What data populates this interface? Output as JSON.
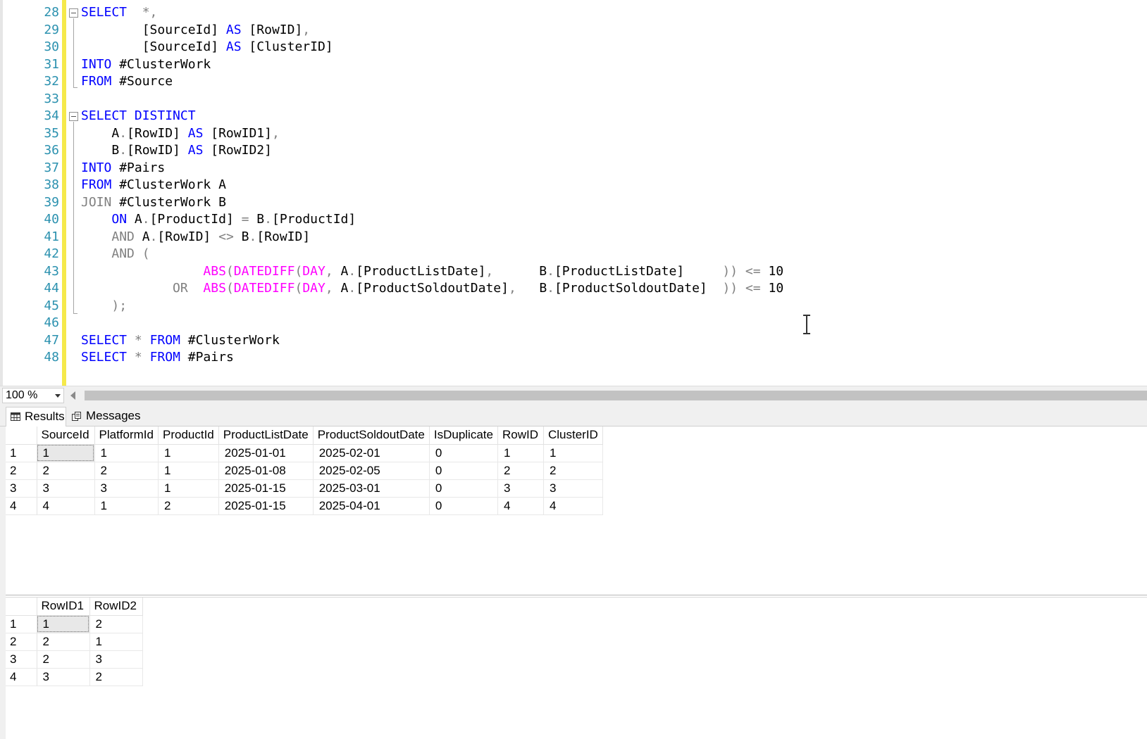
{
  "editor": {
    "line_numbers": [
      "28",
      "29",
      "30",
      "31",
      "32",
      "33",
      "34",
      "35",
      "36",
      "37",
      "38",
      "39",
      "40",
      "41",
      "42",
      "43",
      "44",
      "45",
      "46",
      "47",
      "48"
    ],
    "lines": [
      [
        [
          "k",
          "SELECT"
        ],
        [
          "o",
          "  *,"
        ]
      ],
      [
        [
          "t",
          "        [SourceId] "
        ],
        [
          "k",
          "AS"
        ],
        [
          "t",
          " [RowID]"
        ],
        [
          "o",
          ","
        ]
      ],
      [
        [
          "t",
          "        [SourceId] "
        ],
        [
          "k",
          "AS"
        ],
        [
          "t",
          " [ClusterID]"
        ]
      ],
      [
        [
          "k",
          "INTO"
        ],
        [
          "t",
          " #ClusterWork"
        ]
      ],
      [
        [
          "k",
          "FROM"
        ],
        [
          "t",
          " #Source"
        ]
      ],
      [],
      [
        [
          "k",
          "SELECT DISTINCT"
        ]
      ],
      [
        [
          "t",
          "    A"
        ],
        [
          "o",
          "."
        ],
        [
          "t",
          "[RowID] "
        ],
        [
          "k",
          "AS"
        ],
        [
          "t",
          " [RowID1]"
        ],
        [
          "o",
          ","
        ]
      ],
      [
        [
          "t",
          "    B"
        ],
        [
          "o",
          "."
        ],
        [
          "t",
          "[RowID] "
        ],
        [
          "k",
          "AS"
        ],
        [
          "t",
          " [RowID2]"
        ]
      ],
      [
        [
          "k",
          "INTO"
        ],
        [
          "t",
          " #Pairs"
        ]
      ],
      [
        [
          "k",
          "FROM"
        ],
        [
          "t",
          " #ClusterWork A"
        ]
      ],
      [
        [
          "o",
          "JOIN"
        ],
        [
          "t",
          " #ClusterWork B"
        ]
      ],
      [
        [
          "t",
          "    "
        ],
        [
          "k",
          "ON"
        ],
        [
          "t",
          " A"
        ],
        [
          "o",
          "."
        ],
        [
          "t",
          "[ProductId] "
        ],
        [
          "o",
          "="
        ],
        [
          "t",
          " B"
        ],
        [
          "o",
          "."
        ],
        [
          "t",
          "[ProductId]"
        ]
      ],
      [
        [
          "t",
          "    "
        ],
        [
          "o",
          "AND"
        ],
        [
          "t",
          " A"
        ],
        [
          "o",
          "."
        ],
        [
          "t",
          "[RowID] "
        ],
        [
          "o",
          "<>"
        ],
        [
          "t",
          " B"
        ],
        [
          "o",
          "."
        ],
        [
          "t",
          "[RowID]"
        ]
      ],
      [
        [
          "t",
          "    "
        ],
        [
          "o",
          "AND ("
        ]
      ],
      [
        [
          "t",
          "                "
        ],
        [
          "f",
          "ABS"
        ],
        [
          "o",
          "("
        ],
        [
          "f",
          "DATEDIFF"
        ],
        [
          "o",
          "("
        ],
        [
          "f",
          "DAY"
        ],
        [
          "o",
          ","
        ],
        [
          "t",
          " A"
        ],
        [
          "o",
          "."
        ],
        [
          "t",
          "[ProductListDate]"
        ],
        [
          "o",
          ","
        ],
        [
          "t",
          "      B"
        ],
        [
          "o",
          "."
        ],
        [
          "t",
          "[ProductListDate]     "
        ],
        [
          "o",
          "))"
        ],
        [
          "t",
          " "
        ],
        [
          "o",
          "<="
        ],
        [
          "t",
          " 10"
        ]
      ],
      [
        [
          "t",
          "            "
        ],
        [
          "o",
          "OR"
        ],
        [
          "t",
          "  "
        ],
        [
          "f",
          "ABS"
        ],
        [
          "o",
          "("
        ],
        [
          "f",
          "DATEDIFF"
        ],
        [
          "o",
          "("
        ],
        [
          "f",
          "DAY"
        ],
        [
          "o",
          ","
        ],
        [
          "t",
          " A"
        ],
        [
          "o",
          "."
        ],
        [
          "t",
          "[ProductSoldoutDate]"
        ],
        [
          "o",
          ","
        ],
        [
          "t",
          "   B"
        ],
        [
          "o",
          "."
        ],
        [
          "t",
          "[ProductSoldoutDate]  "
        ],
        [
          "o",
          "))"
        ],
        [
          "t",
          " "
        ],
        [
          "o",
          "<="
        ],
        [
          "t",
          " 10"
        ]
      ],
      [
        [
          "t",
          "    "
        ],
        [
          "o",
          ");"
        ]
      ],
      [],
      [
        [
          "k",
          "SELECT"
        ],
        [
          "t",
          " "
        ],
        [
          "o",
          "*"
        ],
        [
          "t",
          " "
        ],
        [
          "k",
          "FROM"
        ],
        [
          "t",
          " #ClusterWork"
        ]
      ],
      [
        [
          "k",
          "SELECT"
        ],
        [
          "t",
          " "
        ],
        [
          "o",
          "*"
        ],
        [
          "t",
          " "
        ],
        [
          "k",
          "FROM"
        ],
        [
          "t",
          " #Pairs"
        ]
      ]
    ]
  },
  "zoom": {
    "value": "100 %"
  },
  "tabs": {
    "results": "Results",
    "messages": "Messages"
  },
  "grid1": {
    "columns": [
      "SourceId",
      "PlatformId",
      "ProductId",
      "ProductListDate",
      "ProductSoldoutDate",
      "IsDuplicate",
      "RowID",
      "ClusterID"
    ],
    "rows": [
      [
        "1",
        "1",
        "1",
        "1",
        "2025-01-01",
        "2025-02-01",
        "0",
        "1",
        "1"
      ],
      [
        "2",
        "2",
        "2",
        "1",
        "2025-01-08",
        "2025-02-05",
        "0",
        "2",
        "2"
      ],
      [
        "3",
        "3",
        "3",
        "1",
        "2025-01-15",
        "2025-03-01",
        "0",
        "3",
        "3"
      ],
      [
        "4",
        "4",
        "1",
        "2",
        "2025-01-15",
        "2025-04-01",
        "0",
        "4",
        "4"
      ]
    ]
  },
  "grid2": {
    "columns": [
      "RowID1",
      "RowID2"
    ],
    "rows": [
      [
        "1",
        "1",
        "2"
      ],
      [
        "2",
        "2",
        "1"
      ],
      [
        "3",
        "2",
        "3"
      ],
      [
        "4",
        "3",
        "2"
      ]
    ]
  }
}
